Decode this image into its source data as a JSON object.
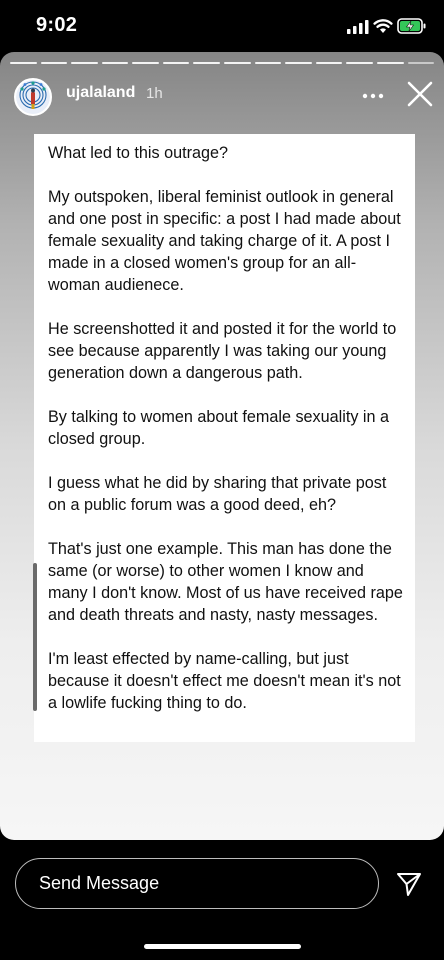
{
  "status_bar": {
    "time": "9:02",
    "icons": [
      "signal-icon",
      "wifi-icon",
      "battery-charging-icon"
    ],
    "battery_color": "#34c759"
  },
  "story": {
    "username": "ujalaland",
    "post_age": "1h",
    "header_icons": [
      "more-options-icon",
      "close-icon"
    ],
    "paragraphs": [
      "What led to this outrage?",
      "My outspoken, liberal feminist outlook in general and one post in specific: a post I had made about female sexuality and taking charge of it. A post I made in a closed women's group for an all-woman audienece.",
      "He screenshotted it and posted it for the world to see because apparently I was taking our young generation down a dangerous path.",
      "By talking to women about female sexuality in a closed group.",
      "I guess what he did by sharing that private post on a public forum was a good deed, eh?",
      "That's just one example. This man has done the same (or worse) to other women I know and many I don't know. Most of us have received rape and death threats and nasty, nasty messages.",
      "I'm least effected by name-calling, but just because it doesn't effect me doesn't mean it's not a lowlife fucking thing to do."
    ]
  },
  "reply": {
    "placeholder": "Send Message",
    "send_icon": "send-icon"
  }
}
